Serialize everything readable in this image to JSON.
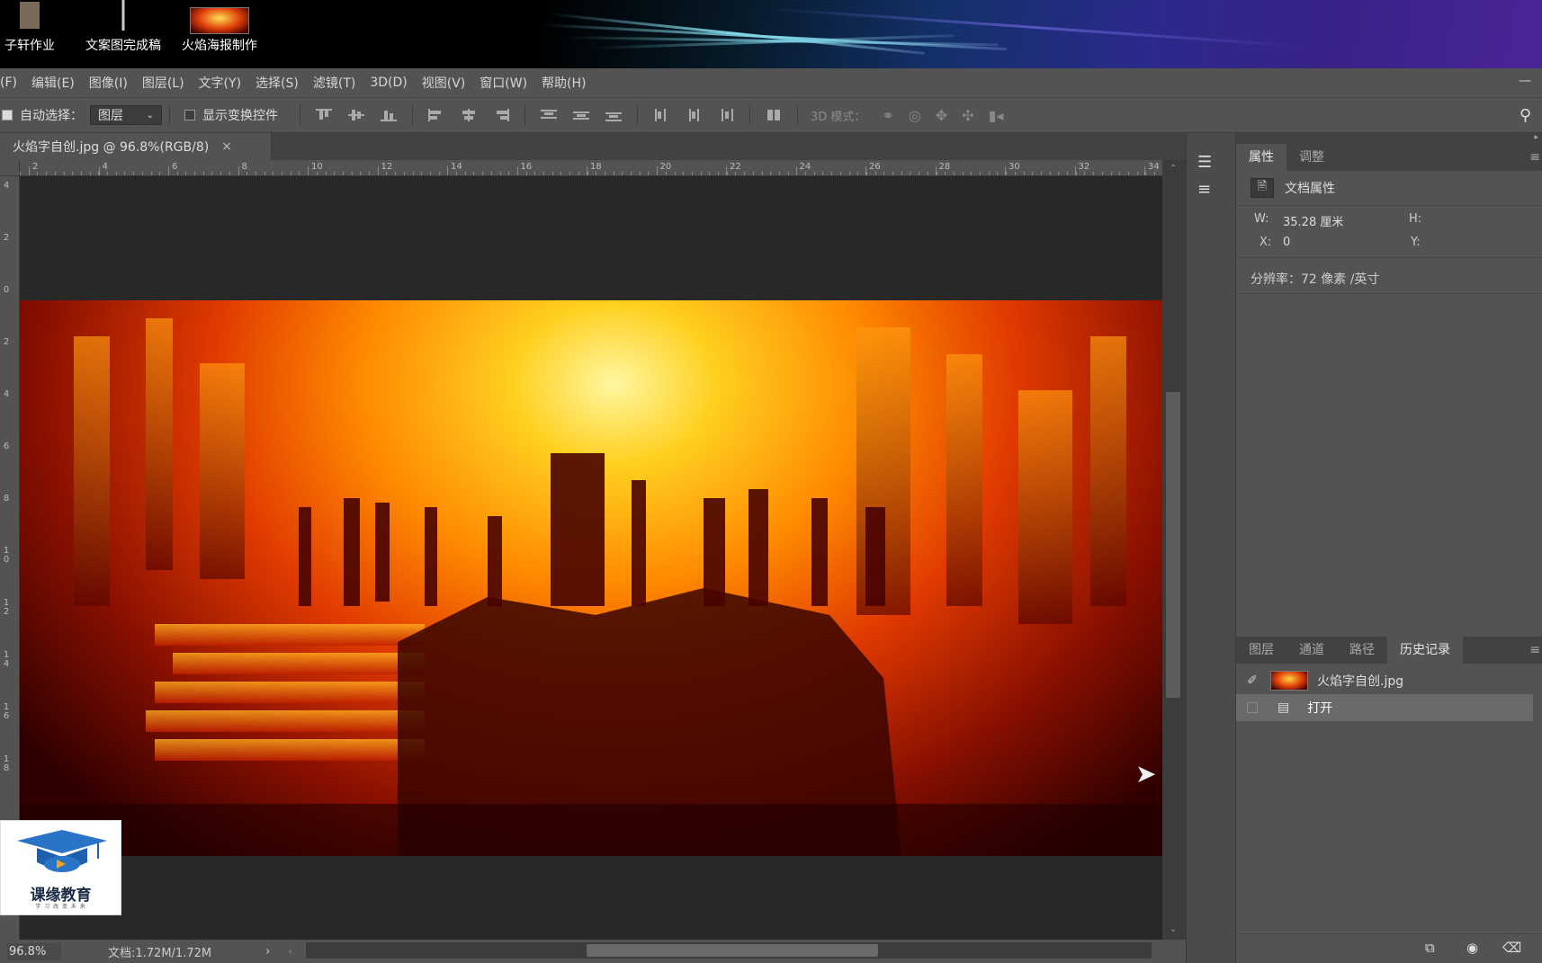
{
  "desktop": {
    "icons": [
      {
        "label": "子轩作业"
      },
      {
        "label": "文案图完成稿"
      },
      {
        "label": "火焰海报制作"
      }
    ]
  },
  "menubar": {
    "items": [
      "(F)",
      "编辑(E)",
      "图像(I)",
      "图层(L)",
      "文字(Y)",
      "选择(S)",
      "滤镜(T)",
      "3D(D)",
      "视图(V)",
      "窗口(W)",
      "帮助(H)"
    ],
    "minimize": "—"
  },
  "options": {
    "auto_select_label": "自动选择：",
    "auto_select_value": "图层",
    "show_transform_label": "显示变换控件",
    "mode_3d_label": "3D 模式："
  },
  "document": {
    "tab_title": "火焰字自创.jpg @ 96.8%(RGB/8)",
    "close": "×"
  },
  "rulers": {
    "top": [
      "2",
      "4",
      "6",
      "8",
      "10",
      "12",
      "14",
      "16",
      "18",
      "20",
      "22",
      "24",
      "26",
      "28",
      "30",
      "32",
      "34"
    ],
    "left": [
      "4",
      "2",
      "0",
      "2",
      "4",
      "6",
      "8",
      "10",
      "12",
      "14",
      "16",
      "18"
    ]
  },
  "status": {
    "zoom": "96.8%",
    "doc_size": "文档:1.72M/1.72M",
    "arrow": "›"
  },
  "properties_panel": {
    "tabs": [
      "属性",
      "调整"
    ],
    "active_tab": "属性",
    "section_title": "文档属性",
    "w_label": "W:",
    "w_value": "35.28 厘米",
    "h_label": "H:",
    "x_label": "X:",
    "x_value": "0",
    "y_label": "Y:",
    "resolution": "分辨率：72 像素 /英寸"
  },
  "history_panel": {
    "tabs": [
      "图层",
      "通道",
      "路径",
      "历史记录"
    ],
    "active_tab": "历史记录",
    "snapshot": "火焰字自创.jpg",
    "states": [
      "打开"
    ]
  },
  "logo": {
    "name": "课缘教育",
    "tagline": "学 习 改 变 未 来"
  },
  "colors": {
    "panel_bg": "#535353",
    "tab_bar": "#424242",
    "canvas_bg": "#282828"
  }
}
